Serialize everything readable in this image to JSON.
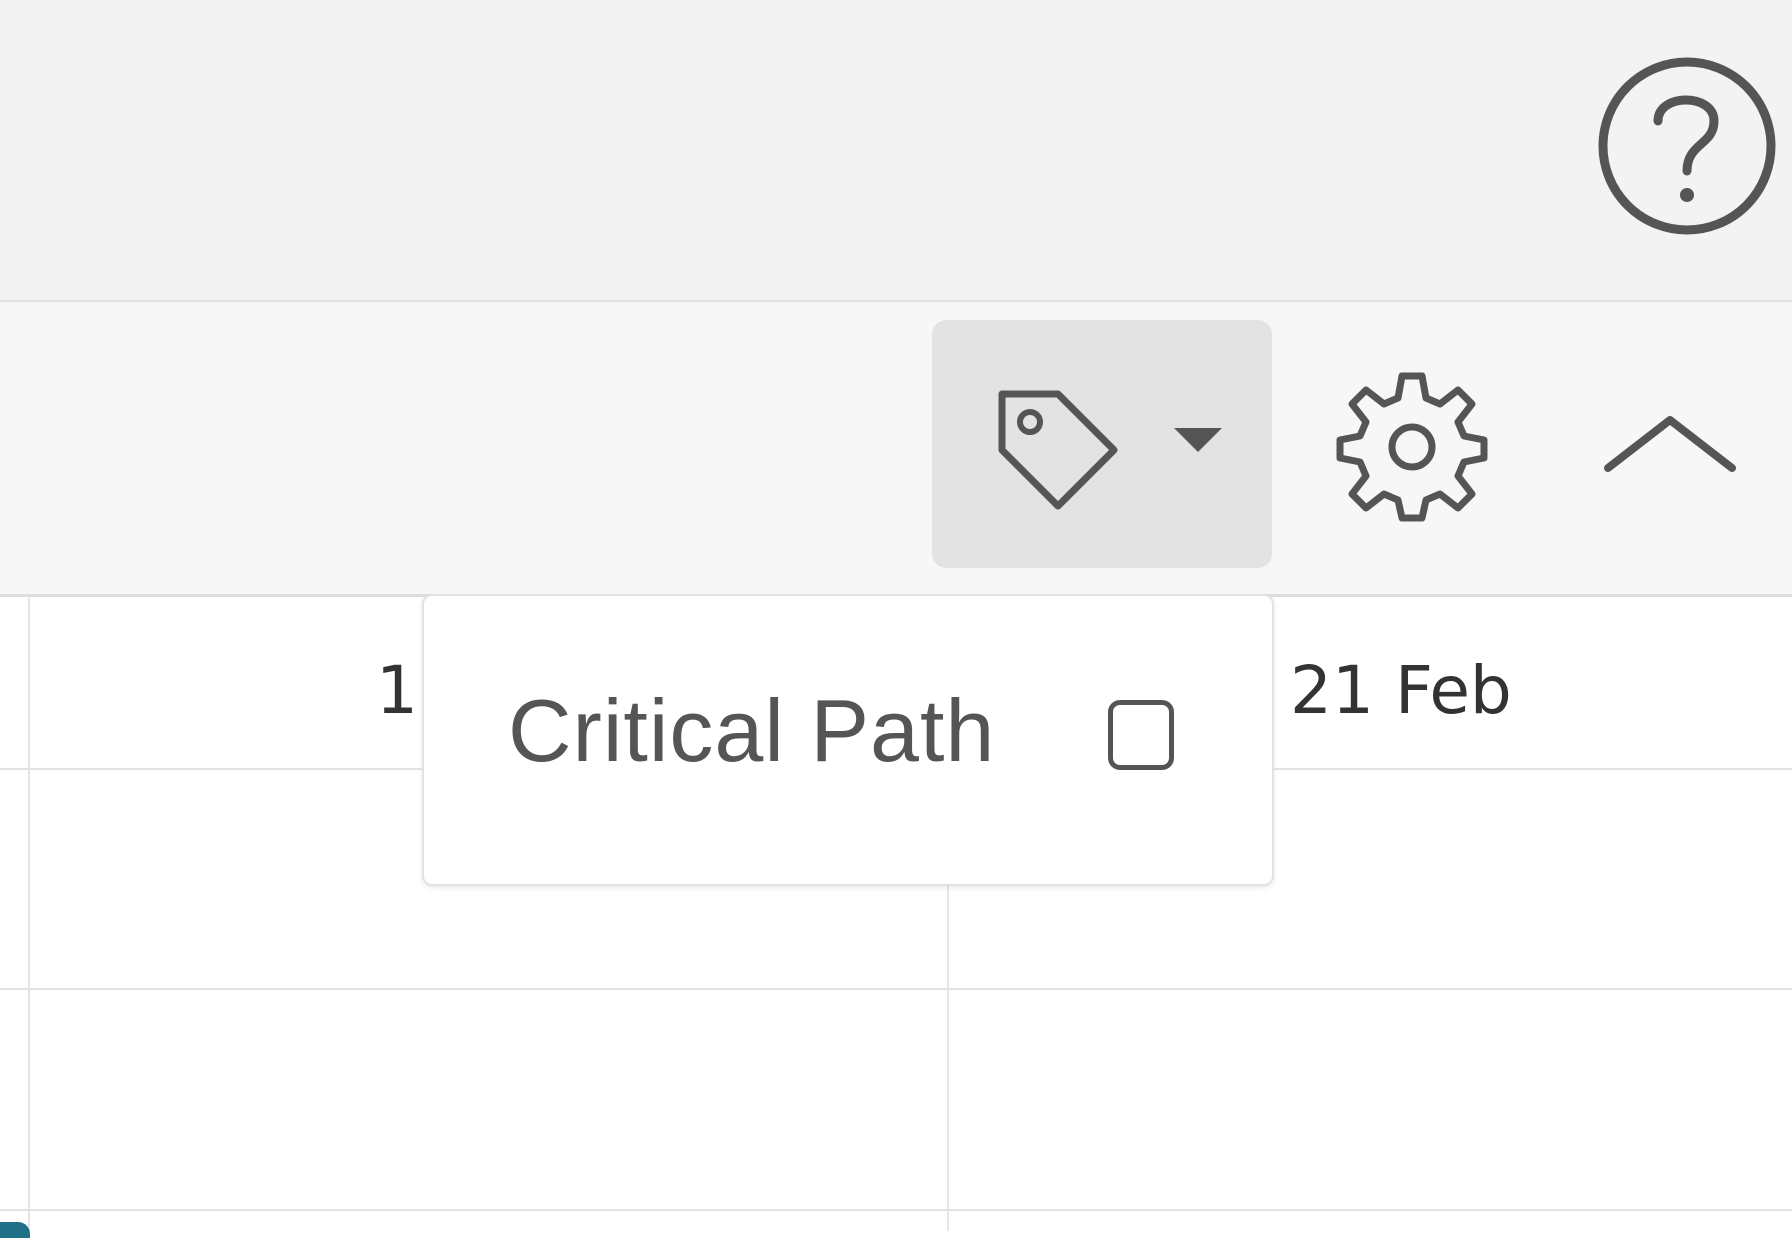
{
  "toolbar": {
    "help_icon": "help-circle-icon",
    "tag_filter_icon": "tag-icon",
    "tag_filter_caret": "caret-down-icon",
    "settings_icon": "gear-icon",
    "collapse_icon": "chevron-up-icon"
  },
  "timeline": {
    "dates": [
      "1",
      "21 Feb"
    ]
  },
  "dropdown": {
    "options": [
      {
        "label": "Critical Path",
        "checked": false
      }
    ]
  },
  "colors": {
    "topbar_bg": "#f3f3f3",
    "toolbar_bg": "#f7f7f7",
    "active_button_bg": "#e3e3e3",
    "icon": "#555555",
    "task_bar": "#1f6f86"
  }
}
